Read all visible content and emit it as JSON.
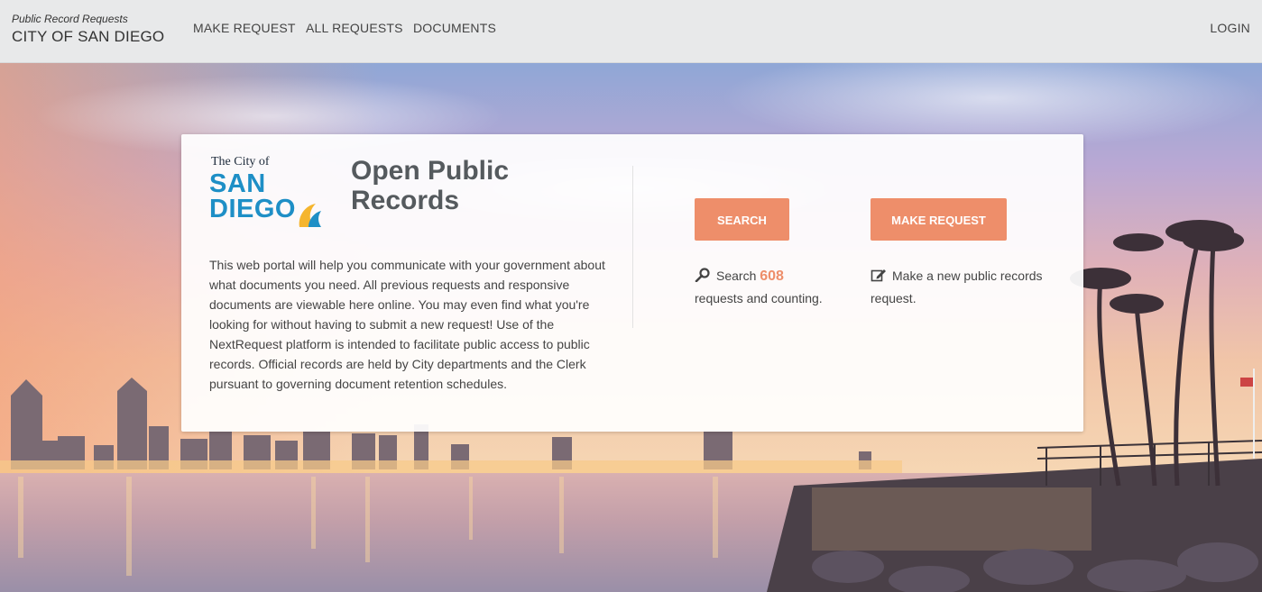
{
  "brand": {
    "subtitle": "Public Record Requests",
    "title": "CITY OF SAN DIEGO"
  },
  "nav": {
    "links": [
      "MAKE REQUEST",
      "ALL REQUESTS",
      "DOCUMENTS"
    ],
    "login": "LOGIN"
  },
  "logo": {
    "line1": "The City of",
    "line2": "SAN",
    "line3": "DIEGO"
  },
  "card": {
    "title": "Open Public Records",
    "description": "This web portal will help you communicate with your government about what documents you need. All previous requests and responsive documents are viewable here online. You may even find what you're looking for without having to submit a new request! Use of the NextRequest platform is intended to facilitate public access to public records. Official records are held by City departments and the Clerk pursuant to governing document retention schedules."
  },
  "actions": {
    "search_label": "SEARCH",
    "make_request_label": "MAKE REQUEST",
    "search_prefix": "Search",
    "search_count": "608",
    "search_suffix": "requests and counting.",
    "make_text": "Make a new public records request."
  },
  "icons": {
    "search": "search-icon",
    "edit": "edit-icon"
  },
  "colors": {
    "accent": "#ee8e6a",
    "logo_blue": "#1e8fc6",
    "nav_bg": "#e8e9ea"
  }
}
